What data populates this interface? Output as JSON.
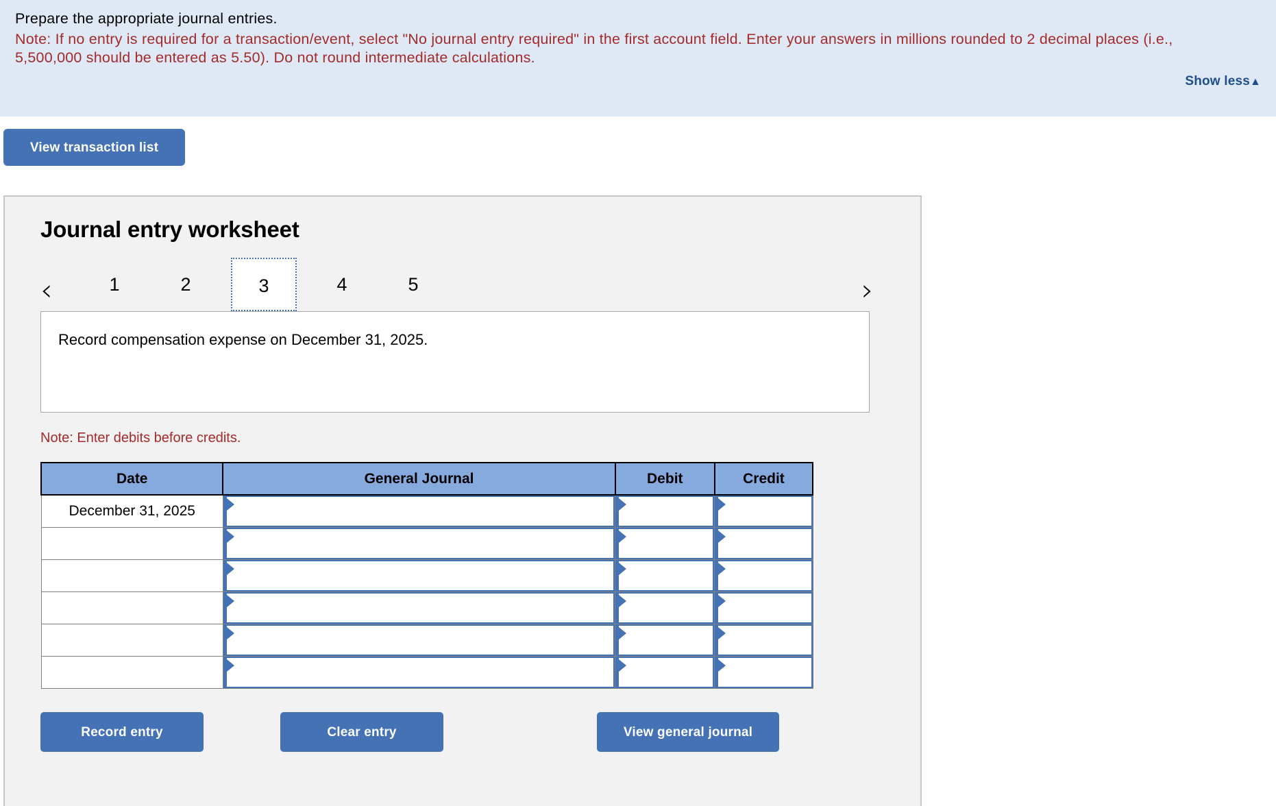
{
  "banner": {
    "instruction": "Prepare the appropriate journal entries.",
    "note": "Note: If no entry is required for a transaction/event, select \"No journal entry required\" in the first account field. Enter your answers in millions rounded to 2 decimal places (i.e., 5,500,000 should be entered as 5.50). Do not round intermediate calculations.",
    "show_less_label": "Show less",
    "show_less_caret": "▲",
    "background_color": "#dee9f5",
    "note_color": "#a52a2a",
    "link_color": "#1f4e8c"
  },
  "toolbar": {
    "view_transaction_list_label": "View transaction list"
  },
  "worksheet": {
    "title": "Journal entry worksheet",
    "pager": {
      "prev_icon": "‹",
      "next_icon": "›",
      "pages": [
        "1",
        "2",
        "3",
        "4",
        "5"
      ],
      "active_page": "3"
    },
    "transaction_description": "Record compensation expense on December 31, 2025.",
    "debit_note": "Note: Enter debits before credits.",
    "table": {
      "columns": [
        "Date",
        "General Journal",
        "Debit",
        "Credit"
      ],
      "rows": [
        {
          "date": "December 31, 2025",
          "general_journal": "",
          "debit": "",
          "credit": ""
        },
        {
          "date": "",
          "general_journal": "",
          "debit": "",
          "credit": ""
        },
        {
          "date": "",
          "general_journal": "",
          "debit": "",
          "credit": ""
        },
        {
          "date": "",
          "general_journal": "",
          "debit": "",
          "credit": ""
        },
        {
          "date": "",
          "general_journal": "",
          "debit": "",
          "credit": ""
        },
        {
          "date": "",
          "general_journal": "",
          "debit": "",
          "credit": ""
        }
      ],
      "header_color": "#87aade",
      "field_accent_color": "#4472b4"
    },
    "actions": {
      "record_entry_label": "Record entry",
      "clear_entry_label": "Clear entry",
      "view_general_journal_label": "View general journal"
    },
    "button_color": "#4472b4",
    "panel_color": "#f2f2f2"
  }
}
